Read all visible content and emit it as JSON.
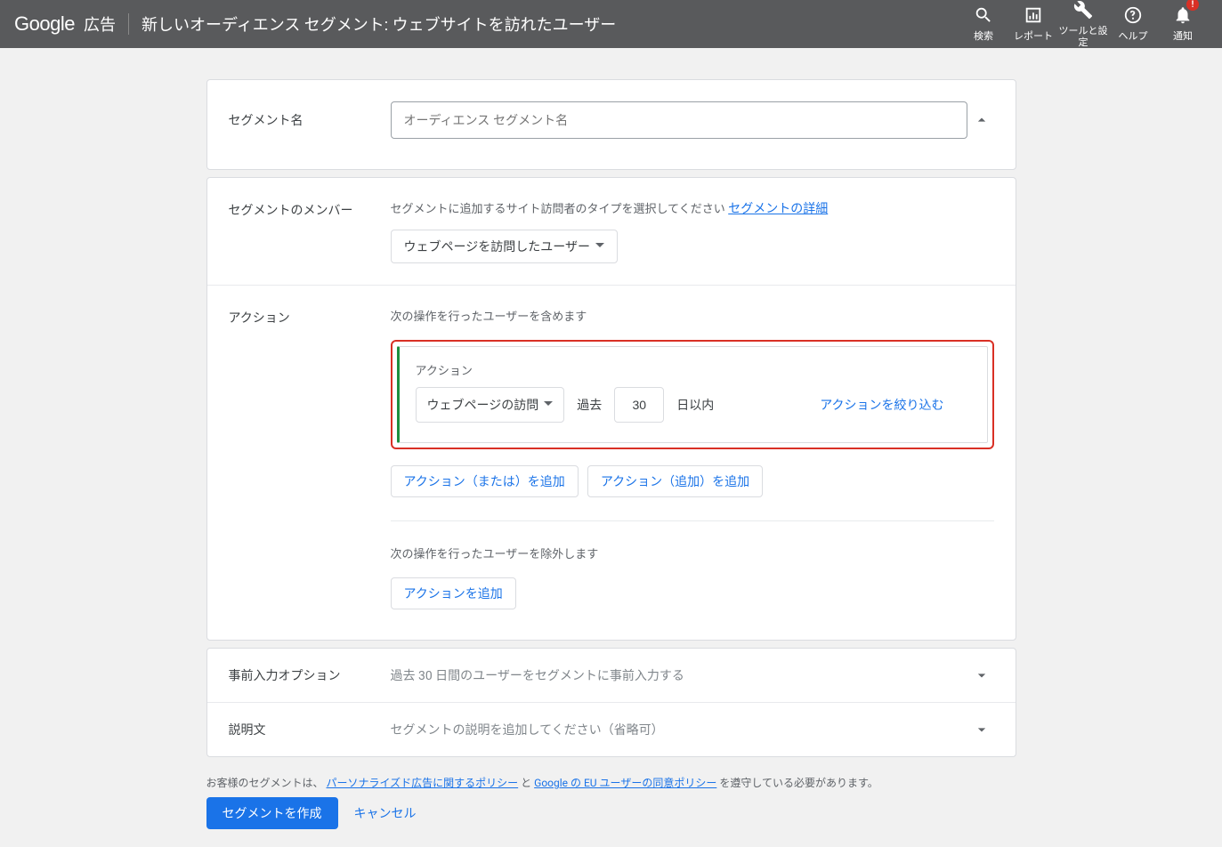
{
  "header": {
    "logo_main": "Google",
    "logo_sub": "広告",
    "title": "新しいオーディエンス セグメント: ウェブサイトを訪れたユーザー",
    "nav": {
      "search": "検索",
      "report": "レポート",
      "tools": "ツールと設定",
      "help": "ヘルプ",
      "notifications": "通知",
      "badge": "!"
    }
  },
  "segment_name": {
    "label": "セグメント名",
    "placeholder": "オーディエンス セグメント名",
    "value": ""
  },
  "members": {
    "label": "セグメントのメンバー",
    "help": "セグメントに追加するサイト訪問者のタイプを選択してください",
    "details_link": "セグメントの詳細",
    "dropdown": "ウェブページを訪問したユーザー"
  },
  "actions": {
    "label": "アクション",
    "include_heading": "次の操作を行ったユーザーを含めます",
    "action_subtitle": "アクション",
    "page_visit": "ウェブページの訪問",
    "past": "過去",
    "days_value": "30",
    "days_suffix": "日以内",
    "refine": "アクションを絞り込む",
    "add_or": "アクション（または）を追加",
    "add_add": "アクション（追加）を追加",
    "exclude_heading": "次の操作を行ったユーザーを除外します",
    "add_action": "アクションを追加"
  },
  "prefill": {
    "label": "事前入力オプション",
    "text": "過去 30 日間のユーザーをセグメントに事前入力する"
  },
  "description": {
    "label": "説明文",
    "text": "セグメントの説明を追加してください（省略可）"
  },
  "footer": {
    "note_prefix": "お客様のセグメントは、",
    "policy1": "パーソナライズド広告に関するポリシー",
    "conj": "と",
    "policy2": "Google の EU ユーザーの同意ポリシー",
    "note_suffix": "を遵守している必要があります。",
    "create": "セグメントを作成",
    "cancel": "キャンセル"
  }
}
